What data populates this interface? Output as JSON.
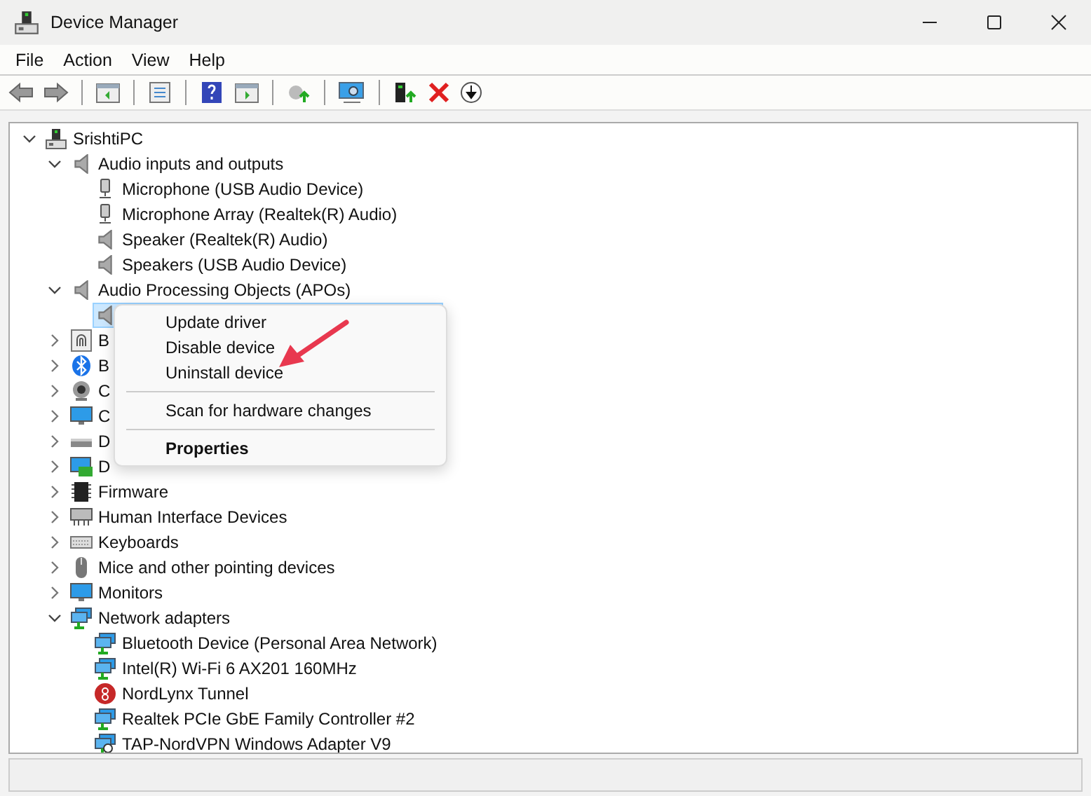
{
  "window": {
    "title": "Device Manager"
  },
  "menu": [
    "File",
    "Action",
    "View",
    "Help"
  ],
  "tree": [
    {
      "label": "SrishtiPC",
      "kind": "computer",
      "expanded": true,
      "children": [
        {
          "label": "Audio inputs and outputs",
          "kind": "speaker",
          "expanded": true,
          "children": [
            {
              "label": "Microphone (USB Audio Device)",
              "kind": "microphone",
              "selected": false
            },
            {
              "label": "Microphone Array (Realtek(R) Audio)",
              "kind": "microphone",
              "selected": false
            },
            {
              "label": "Speaker (Realtek(R) Audio)",
              "kind": "speaker",
              "selected": false
            },
            {
              "label": "Speakers (USB Audio Device)",
              "kind": "speaker",
              "selected": false
            }
          ]
        },
        {
          "label": "Audio Processing Objects (APOs)",
          "kind": "speaker",
          "expanded": true,
          "children": [
            {
              "kind": "speaker",
              "selected": true
            }
          ]
        },
        {
          "label": "B",
          "kind": "fingerprint",
          "expanded": false
        },
        {
          "label": "B",
          "kind": "bluetooth",
          "expanded": false
        },
        {
          "label": "C",
          "kind": "camera",
          "expanded": false
        },
        {
          "label": "C",
          "kind": "monitor",
          "expanded": false
        },
        {
          "label": "D",
          "kind": "drive",
          "expanded": false
        },
        {
          "label": "D",
          "kind": "adapter",
          "expanded": false
        },
        {
          "label": "Firmware",
          "kind": "chip",
          "expanded": false
        },
        {
          "label": "Human Interface Devices",
          "kind": "hid",
          "expanded": false
        },
        {
          "label": "Keyboards",
          "kind": "keyboard",
          "expanded": false
        },
        {
          "label": "Mice and other pointing devices",
          "kind": "mouse",
          "expanded": false
        },
        {
          "label": "Monitors",
          "kind": "monitor",
          "expanded": false
        },
        {
          "label": "Network adapters",
          "kind": "network",
          "expanded": true,
          "children": [
            {
              "label": "Bluetooth Device (Personal Area Network)",
              "kind": "network",
              "selected": false
            },
            {
              "label": "Intel(R) Wi-Fi 6 AX201 160MHz",
              "kind": "network",
              "selected": false
            },
            {
              "label": "NordLynx Tunnel",
              "kind": "nordlynx",
              "selected": false
            },
            {
              "label": "Realtek PCIe GbE Family Controller #2",
              "kind": "network",
              "selected": false
            },
            {
              "label": "TAP-NordVPN Windows Adapter V9",
              "kind": "tap",
              "selected": false
            }
          ]
        }
      ]
    }
  ],
  "context_menu": [
    {
      "kind": "item",
      "label": "Update driver"
    },
    {
      "kind": "item",
      "label": "Disable device"
    },
    {
      "kind": "item",
      "label": "Uninstall device"
    },
    {
      "kind": "separator"
    },
    {
      "kind": "item",
      "label": "Scan for hardware changes"
    },
    {
      "kind": "separator"
    },
    {
      "kind": "default",
      "label": "Properties"
    }
  ]
}
